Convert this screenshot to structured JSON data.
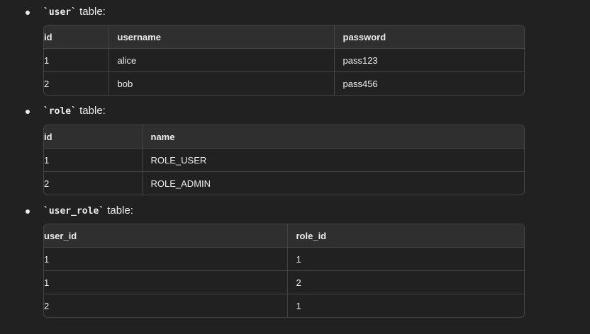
{
  "sections": [
    {
      "code": "`user`",
      "suffix": " table:",
      "columns": [
        "id",
        "username",
        "password"
      ],
      "rows": [
        [
          "1",
          "alice",
          "pass123"
        ],
        [
          "2",
          "bob",
          "pass456"
        ]
      ]
    },
    {
      "code": "`role`",
      "suffix": " table:",
      "columns": [
        "id",
        "name"
      ],
      "rows": [
        [
          "1",
          "ROLE_USER"
        ],
        [
          "2",
          "ROLE_ADMIN"
        ]
      ]
    },
    {
      "code": "`user_role`",
      "suffix": " table:",
      "columns": [
        "user_id",
        "role_id"
      ],
      "rows": [
        [
          "1",
          "1"
        ],
        [
          "1",
          "2"
        ],
        [
          "2",
          "1"
        ]
      ]
    }
  ]
}
